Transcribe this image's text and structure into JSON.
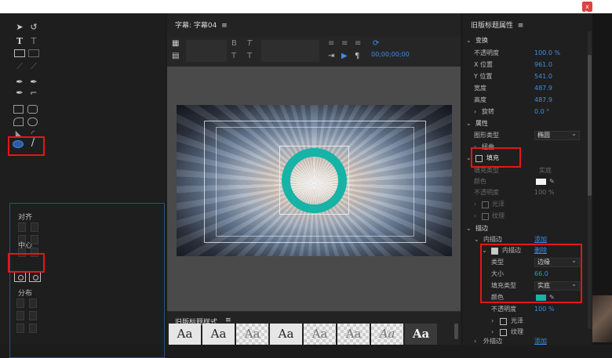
{
  "window": {
    "close_label": "x"
  },
  "tools": {
    "align_title": "对齐",
    "center_title": "中心",
    "distribute_title": "分布"
  },
  "center": {
    "tab_title": "字幕: 字幕04",
    "timecode": "00;00;00;00",
    "styles_title": "旧版标题样式",
    "style_swatches": [
      "Aa",
      "Aa",
      "Aa",
      "Aa",
      "Aa",
      "Aa",
      "Aa",
      "Aa"
    ]
  },
  "props": {
    "title": "旧版标题属性",
    "transform_title": "变换",
    "transform": [
      {
        "label": "不透明度",
        "value": "100.0 %"
      },
      {
        "label": "X 位置",
        "value": "961.0"
      },
      {
        "label": "Y 位置",
        "value": "541.0"
      },
      {
        "label": "宽度",
        "value": "487.9"
      },
      {
        "label": "高度",
        "value": "487.9"
      },
      {
        "label": "旋转",
        "value": "0.0 °"
      }
    ],
    "attributes_title": "属性",
    "shape_type_label": "图形类型",
    "shape_type_value": "椭圆",
    "distort_label": "扭曲",
    "fill_label": "填充",
    "fill_type_label": "填充类型",
    "fill_type_value": "实底",
    "fill_color_label": "颜色",
    "fill_opacity_label": "不透明度",
    "fill_opacity_value": "100 %",
    "sheen_label": "光泽",
    "texture_label": "纹理",
    "stroke_title": "描边",
    "inner_stroke_label": "内描边",
    "add_label": "添加",
    "inner_stroke_item": "内描边",
    "delete_label": "删除",
    "type_label": "类型",
    "type_value": "边缘",
    "size_label": "大小",
    "size_value": "66.0",
    "stroke_fill_type_label": "填充类型",
    "stroke_fill_type_value": "实底",
    "stroke_color_label": "颜色",
    "stroke_opacity_label": "不透明度",
    "stroke_opacity_value": "100 %",
    "stroke_sheen_label": "光泽",
    "stroke_texture_label": "纹理",
    "outer_stroke_label": "外描边",
    "outer_add_label": "添加",
    "colors": {
      "fill": "#f4f4f4",
      "stroke": "#16b3a6",
      "accent": "#3f8de3",
      "highlight": "#e3161a"
    }
  }
}
